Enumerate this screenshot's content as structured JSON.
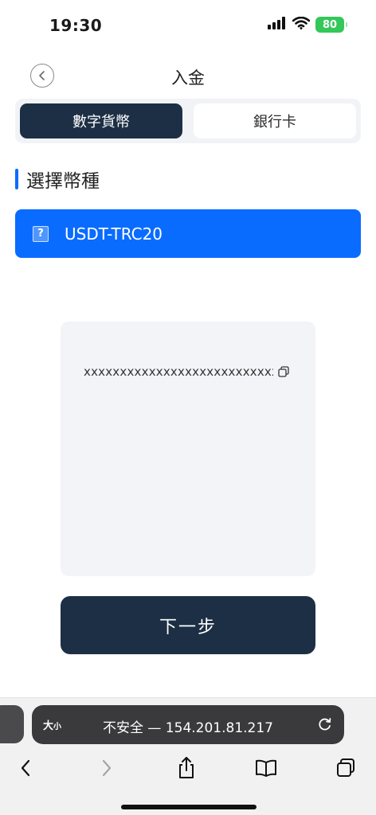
{
  "status_bar": {
    "time": "19:30",
    "battery": "80",
    "signal_icon": "cellular-signal-icon",
    "wifi_icon": "wifi-icon",
    "battery_color": "#34c759"
  },
  "header": {
    "title": "入金",
    "back_icon": "chevron-left-icon"
  },
  "tabs": [
    {
      "label": "數字貨幣",
      "active": true
    },
    {
      "label": "銀行卡",
      "active": false
    }
  ],
  "section": {
    "title": "選擇幣種",
    "accent_color": "#0a6cff"
  },
  "currency_option": {
    "label": "USDT-TRC20",
    "icon": "broken-image-icon",
    "selected": true,
    "color": "#0a6cff"
  },
  "address_card": {
    "address": "xxxxxxxxxxxxxxxxxxxxxxxxxxxxx",
    "copy_icon": "copy-icon"
  },
  "next_button": {
    "label": "下一步",
    "color": "#1c2f45"
  },
  "browser": {
    "text_size_big": "大",
    "text_size_small": "小",
    "url": "不安全 — 154.201.81.217",
    "reload_icon": "reload-icon",
    "toolbar": [
      "back-arrow-icon",
      "forward-arrow-icon",
      "share-icon",
      "bookmarks-icon",
      "tabs-icon"
    ]
  }
}
